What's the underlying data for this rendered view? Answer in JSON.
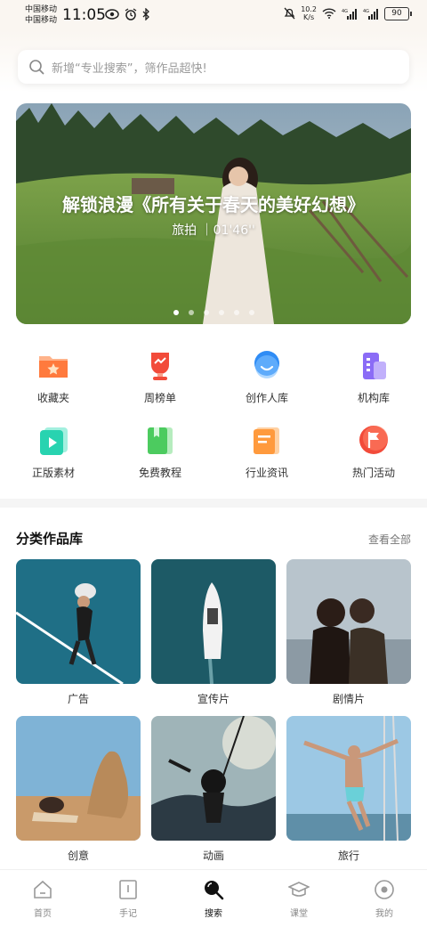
{
  "status_bar": {
    "carrier1": "中国移动",
    "carrier2": "中国移动",
    "time": "11:05",
    "speed_value": "10.2",
    "speed_unit": "K/s",
    "battery": "90"
  },
  "search": {
    "placeholder": "新增“专业搜索”，筛作品超快!"
  },
  "banner": {
    "title": "解锁浪漫《所有关于春天的美好幻想》",
    "subtitle": "旅拍  ｜01'46''",
    "dots": 6,
    "active_dot": 0
  },
  "quick_grid": [
    {
      "label": "收藏夹",
      "icon": "folder-star-icon",
      "color": "#ff7a3d"
    },
    {
      "label": "周榜单",
      "icon": "trophy-icon",
      "color": "#f24b3a"
    },
    {
      "label": "创作人库",
      "icon": "creator-face-icon",
      "color": "#2f8cf5"
    },
    {
      "label": "机构库",
      "icon": "building-icon",
      "color": "#8b6cf6"
    },
    {
      "label": "正版素材",
      "icon": "play-media-icon",
      "color": "#28d3b0"
    },
    {
      "label": "免费教程",
      "icon": "book-icon",
      "color": "#4ccb5f"
    },
    {
      "label": "行业资讯",
      "icon": "news-icon",
      "color": "#ff9a3d"
    },
    {
      "label": "热门活动",
      "icon": "flag-icon",
      "color": "#f24b3a"
    }
  ],
  "section": {
    "title": "分类作品库",
    "view_all": "查看全部"
  },
  "categories": [
    {
      "label": "广告",
      "thumb": "person-on-court-thumb"
    },
    {
      "label": "宣传片",
      "thumb": "yacht-aerial-thumb"
    },
    {
      "label": "剧情片",
      "thumb": "couple-sunset-thumb"
    },
    {
      "label": "创意",
      "thumb": "camel-desert-thumb"
    },
    {
      "label": "动画",
      "thumb": "animated-characters-thumb"
    },
    {
      "label": "旅行",
      "thumb": "boat-jump-thumb"
    }
  ],
  "tabs": [
    {
      "label": "首页",
      "icon": "home-icon",
      "active": false
    },
    {
      "label": "手记",
      "icon": "notebook-icon",
      "active": false
    },
    {
      "label": "搜索",
      "icon": "search-tab-icon",
      "active": true
    },
    {
      "label": "课堂",
      "icon": "graduation-cap-icon",
      "active": false
    },
    {
      "label": "我的",
      "icon": "profile-circle-icon",
      "active": false
    }
  ]
}
